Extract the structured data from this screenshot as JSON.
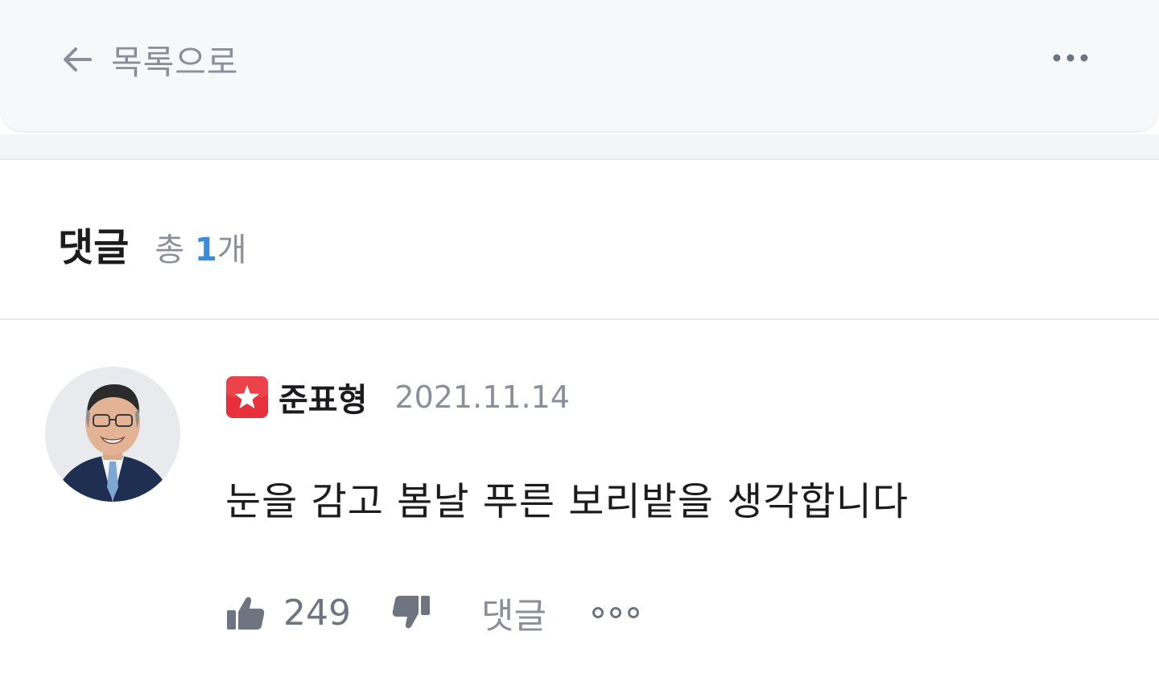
{
  "topbar": {
    "back_label": "목록으로",
    "back_icon": "arrow-left-icon",
    "more_icon": "more-horizontal-icon"
  },
  "comments": {
    "title": "댓글",
    "count_prefix": "총",
    "count": "1",
    "count_suffix": "개"
  },
  "comment": {
    "author": "준표형",
    "badge_icon": "star-badge-icon",
    "date": "2021.11.14",
    "text": "눈을 감고 봄날 푸른 보리밭을 생각합니다",
    "likes": "249",
    "reply_label": "댓글",
    "like_icon": "thumbs-up-icon",
    "dislike_icon": "thumbs-down-icon",
    "more_icon": "more-horizontal-icon"
  },
  "colors": {
    "accent_blue": "#3a8bdc",
    "badge_red": "#e8303a",
    "muted_text": "#8a8f99",
    "topbar_bg": "#f7f8fa"
  }
}
